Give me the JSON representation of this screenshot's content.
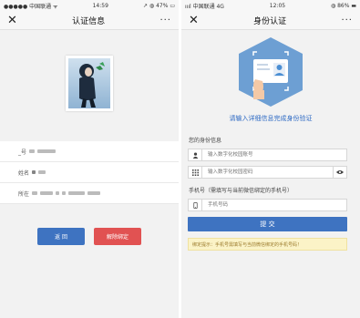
{
  "left": {
    "status": {
      "carrier": "●●●●● 中国联通 ᯤ",
      "time": "14:59",
      "battery": "↗ ◍ 47% ▭"
    },
    "nav": {
      "title": "认证信息",
      "close": "✕",
      "more": "···"
    },
    "info": {
      "rows": [
        {
          "label": "_号"
        },
        {
          "label": "姓名"
        },
        {
          "label": "所在"
        }
      ]
    },
    "buttons": {
      "back": "返 回",
      "unbind": "解除绑定"
    },
    "colors": {
      "back": "#3e73c1",
      "unbind": "#e15252"
    }
  },
  "right": {
    "status": {
      "carrier": "ıııl 中国联通 4G",
      "time": "12:05",
      "battery": "◍ 86% ▬"
    },
    "nav": {
      "title": "身份认证",
      "close": "✕",
      "more": "···"
    },
    "prompt": "请输入详细信息完成身份验证",
    "section_identity": "您的身份信息",
    "account_placeholder": "输入数字化校园账号",
    "password_placeholder": "输入数字化校园密码",
    "section_phone": "手机号（需填写与当前微信绑定的手机号）",
    "phone_placeholder": "手机号码",
    "submit": "提 交",
    "tip": "绑定提示：手机号需填写与当前微信绑定的手机号码！",
    "icons": {
      "account": "user-icon",
      "password": "keypad-icon",
      "eye": "eye-icon",
      "phone": "phone-icon"
    },
    "colors": {
      "accent": "#3e73c1",
      "prompt": "#2f6bc4",
      "tip_bg": "#fbf3c7"
    }
  }
}
